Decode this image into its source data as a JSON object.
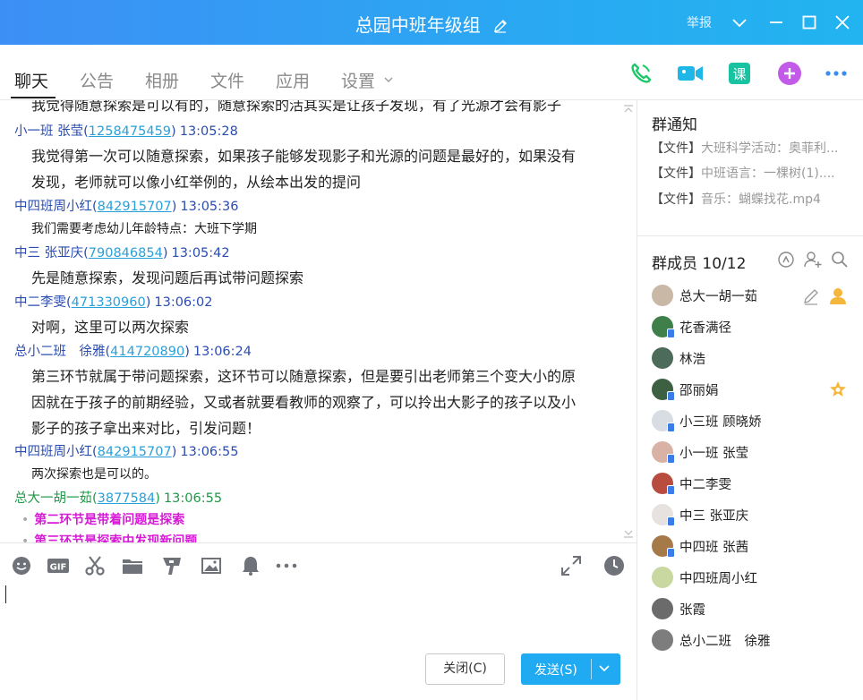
{
  "window": {
    "title": "总园中班年级组",
    "report_label": "举报"
  },
  "tabs": [
    {
      "label": "聊天",
      "active": true
    },
    {
      "label": "公告"
    },
    {
      "label": "相册"
    },
    {
      "label": "文件"
    },
    {
      "label": "应用"
    },
    {
      "label": "设置"
    }
  ],
  "header_actions": [
    "phone-icon",
    "video-call-icon",
    "course-icon",
    "add-app-icon",
    "more-icon"
  ],
  "messages": [
    {
      "text": "我觉得随意探索是可以有的，随意探索的活其实是让孩子发现，有了光源才会有影子"
    },
    {
      "sender": "小一班 张莹",
      "qq": "1258475459",
      "time": "13:05:28"
    },
    {
      "text": "我觉得第一次可以随意探索，如果孩子能够发现影子和光源的问题是最好的，如果没有"
    },
    {
      "text": "发现，老师就可以像小红举例的，从绘本出发的提问"
    },
    {
      "sender": "中四班周小红",
      "qq": "842915707",
      "time": "13:05:36"
    },
    {
      "text": "我们需要考虑幼儿年龄特点：大班下学期"
    },
    {
      "sender": "中三 张亚庆",
      "qq": "790846854",
      "time": "13:05:42"
    },
    {
      "text": "先是随意探索，发现问题后再试带问题探索"
    },
    {
      "sender": "中二李雯",
      "qq": "471330960",
      "time": "13:06:02"
    },
    {
      "text": "对啊，这里可以两次探索"
    },
    {
      "sender": "总小二班　徐雅",
      "qq": "414720890",
      "time": "13:06:24"
    },
    {
      "text": "第三环节就属于带问题探索，这环节可以随意探索，但是要引出老师第三个变大小的原"
    },
    {
      "text": "因就在于孩子的前期经验，又或者就要看教师的观察了，可以拎出大影子的孩子以及小"
    },
    {
      "text": "影子的孩子拿出来对比，引发问题！"
    },
    {
      "sender": "中四班周小红",
      "qq": "842915707",
      "time": "13:06:55"
    },
    {
      "text": "两次探索也是可以的。"
    },
    {
      "sender": "总大一胡一茹",
      "qq": "3877584",
      "time": "13:06:55"
    },
    {
      "text": "第二环节是带着问题是探索"
    },
    {
      "text": "第三环节是探索中发现新问题"
    }
  ],
  "input_tools": [
    "emoji-icon",
    "gif-icon",
    "scissors-icon",
    "folder-icon",
    "font-icon",
    "image-icon",
    "bell-icon",
    "more-tools-icon"
  ],
  "buttons": {
    "close": "关闭(C)",
    "send": "发送(S)"
  },
  "notice": {
    "title": "群通知",
    "items": [
      {
        "tag": "【文件】",
        "name": "大班科学活动：奥菲利..."
      },
      {
        "tag": "【文件】",
        "name": "中班语言：一棵树(1)...."
      },
      {
        "tag": "【文件】",
        "name": "音乐：蝴蝶找花.mp4"
      }
    ]
  },
  "members": {
    "title": "群成员 10/12",
    "list": [
      {
        "name": "总大一胡一茹",
        "avatar_color": "#c9b8a6"
      },
      {
        "name": "花香满径",
        "avatar_color": "#3f7f4a"
      },
      {
        "name": "林浩",
        "avatar_color": "#4c6b58"
      },
      {
        "name": "邵丽娟",
        "avatar_color": "#3d5f42"
      },
      {
        "name": "小三班 顾晓娇",
        "avatar_color": "#d7dde3"
      },
      {
        "name": "小一班 张莹",
        "avatar_color": "#d9b2a6"
      },
      {
        "name": "中二李雯",
        "avatar_color": "#b84d3f"
      },
      {
        "name": "中三 张亚庆",
        "avatar_color": "#e7e2df"
      },
      {
        "name": "中四班 张茜",
        "avatar_color": "#a67a48"
      },
      {
        "name": "中四班周小红",
        "avatar_color": "#c8d8a0"
      },
      {
        "name": "张霞",
        "avatar_color": "#6b6b6b"
      },
      {
        "name": "总小二班　徐雅",
        "avatar_color": "#7d7d7d"
      }
    ]
  },
  "colors": {
    "titlebar_start": "#3d8ff5",
    "titlebar_end": "#22b4f0",
    "send_button": "#1faaf1",
    "highlight_magenta": "#d81ad8"
  }
}
